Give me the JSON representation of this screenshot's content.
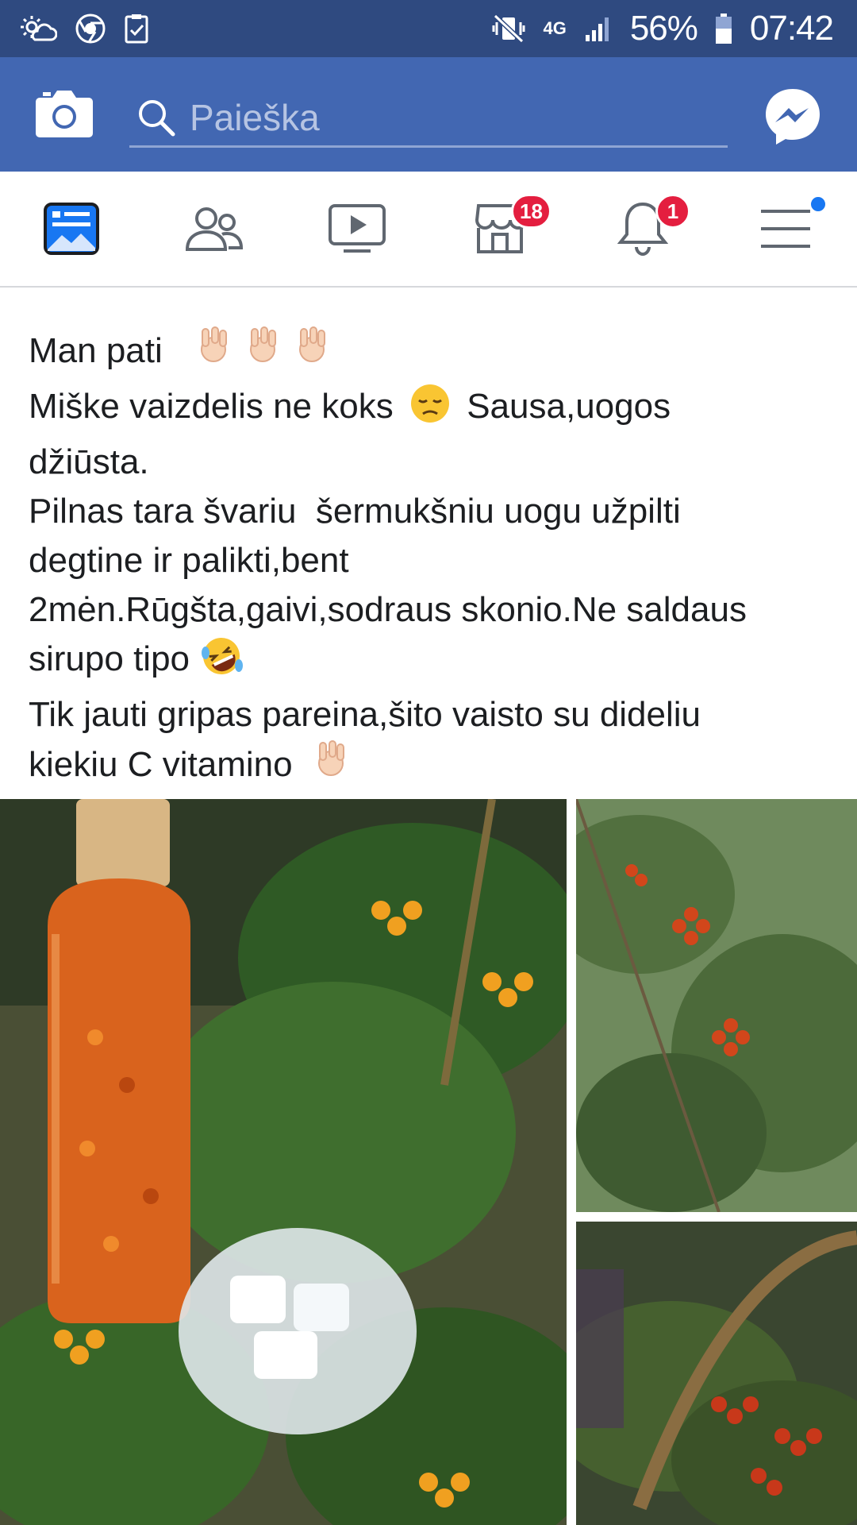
{
  "status_bar": {
    "network": "4G",
    "battery": "56%",
    "time": "07:42",
    "left_icons": [
      "weather-icon",
      "chrome-icon",
      "checklist-icon"
    ],
    "right_icons": [
      "vibrate-mute-icon",
      "network-4g-icon",
      "signal-icon",
      "battery-icon"
    ]
  },
  "header": {
    "search_placeholder": "Paieška",
    "camera_icon": "camera-icon",
    "messenger_icon": "messenger-icon"
  },
  "nav": {
    "tabs": [
      {
        "name": "news-feed",
        "icon": "news-feed-icon",
        "active": true
      },
      {
        "name": "friends",
        "icon": "friends-icon"
      },
      {
        "name": "watch",
        "icon": "video-icon"
      },
      {
        "name": "marketplace",
        "icon": "marketplace-icon",
        "badge": "18"
      },
      {
        "name": "notifications",
        "icon": "bell-icon",
        "badge": "1"
      },
      {
        "name": "menu",
        "icon": "menu-icon",
        "dot": true
      }
    ]
  },
  "post": {
    "lines": [
      "Man pati",
      "Miške vaizdelis ne koks",
      "Sausa,uogos",
      "džiūsta.",
      "Pilnas tara švariu  šermukšniu uogu užpilti",
      "degtine ir palikti,bent",
      "2mėn.Rūgšta,gaivi,sodraus skonio.Ne saldaus",
      "sirupo tipo",
      "Tik jauti gripas pareina,šito vaisto su dideliu",
      "kiekiu C vitamino"
    ],
    "photos": [
      "rowan-berry-bottle-photo",
      "rowan-tree-photo",
      "berry-basket-photo"
    ]
  },
  "colors": {
    "status_bar": "#2f4a80",
    "header": "#4267b2",
    "active_tab": "#1877f2",
    "badge": "#e41e3f",
    "text": "#1c1e21"
  }
}
